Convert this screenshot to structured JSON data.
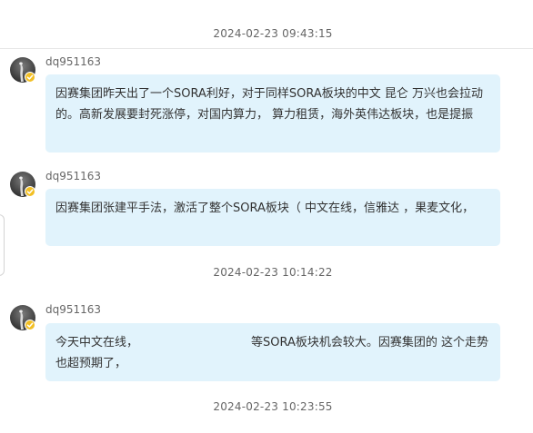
{
  "timestamps": [
    "2024-02-23 09:43:15",
    "2024-02-23 10:14:22",
    "2024-02-23 10:23:55"
  ],
  "messages": [
    {
      "username": "dq951163",
      "text": "因赛集团昨天出了一个SORA利好，对于同样SORA板块的中文 昆仑 万兴也会拉动的。高新发展要封死涨停，对国内算力， 算力租赁，海外英伟达板块，也是提振"
    },
    {
      "username": "dq951163",
      "text": "因赛集团张建平手法，激活了整个SORA板块（ 中文在线，信雅达 ，果麦文化，"
    },
    {
      "username": "dq951163",
      "text": "今天中文在线，                              等SORA板块机会较大。因赛集团的 这个走势也超预期了，"
    }
  ],
  "colors": {
    "bubble": "#e1f3fc",
    "badge": "#f2bf24",
    "text": "#333333",
    "meta": "#666666"
  },
  "icons": {
    "avatar": "user-avatar-dark",
    "badge": "verified-check-badge"
  }
}
